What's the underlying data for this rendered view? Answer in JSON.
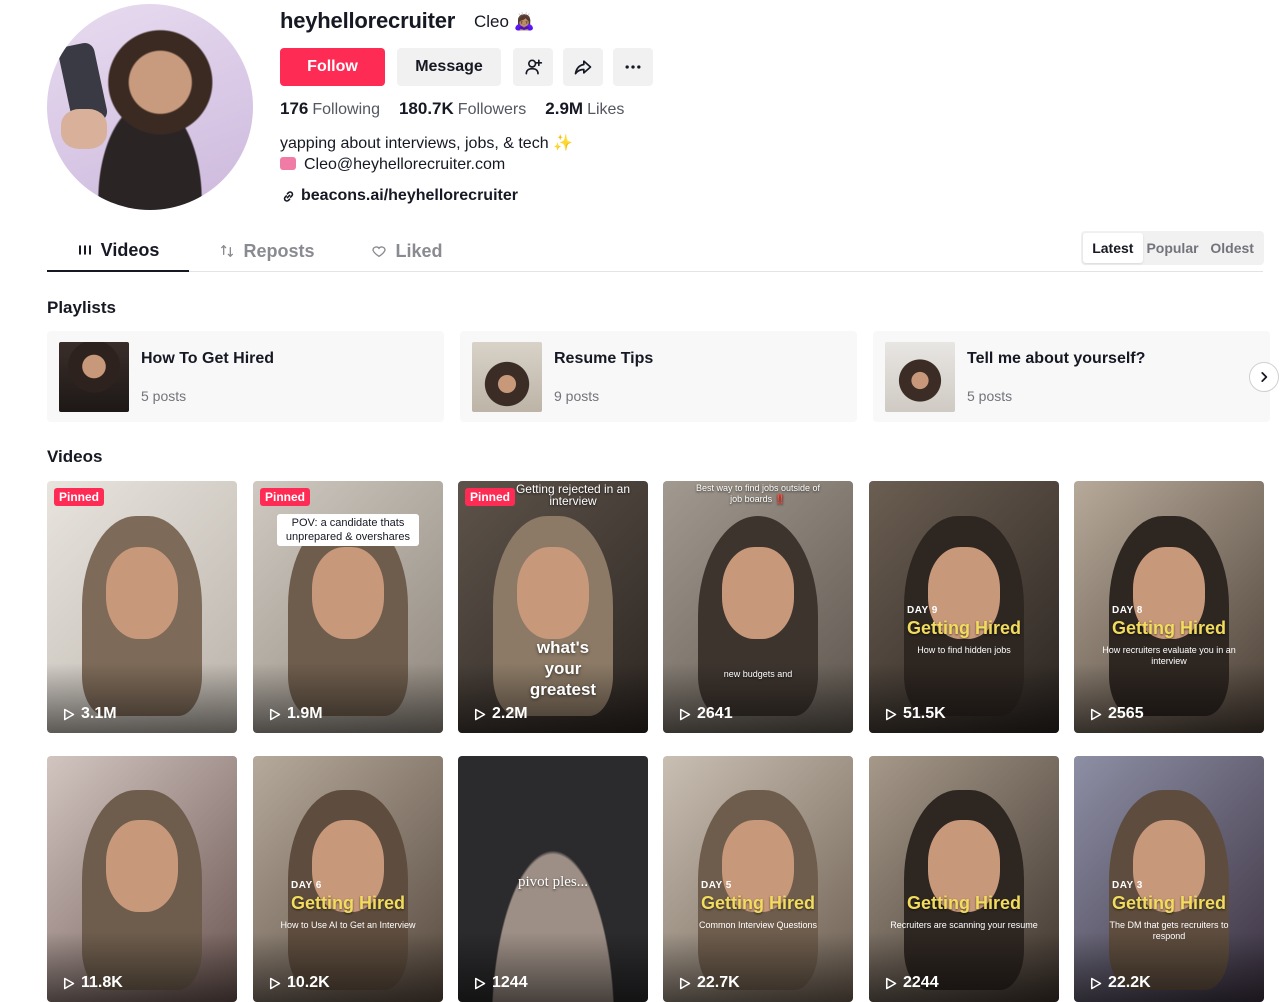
{
  "profile": {
    "username": "heyhellorecruiter",
    "nickname": "Cleo 🙇🏽‍♀️",
    "follow_label": "Follow",
    "message_label": "Message",
    "stats": {
      "following_count": "176",
      "following_label": "Following",
      "followers_count": "180.7K",
      "followers_label": "Followers",
      "likes_count": "2.9M",
      "likes_label": "Likes"
    },
    "bio_line1": "yapping about interviews, jobs, & tech ✨",
    "bio_line2": "Cleo@heyhellorecruiter.com",
    "link": "beacons.ai/heyhellorecruiter"
  },
  "tabs": {
    "videos": "Videos",
    "reposts": "Reposts",
    "liked": "Liked"
  },
  "sort": {
    "latest": "Latest",
    "popular": "Popular",
    "oldest": "Oldest",
    "selected": "Latest"
  },
  "playlists_title": "Playlists",
  "playlists": [
    {
      "name": "How To Get Hired",
      "count": "5 posts"
    },
    {
      "name": "Resume Tips",
      "count": "9 posts"
    },
    {
      "name": "Tell me about yourself?",
      "count": "5 posts"
    }
  ],
  "videos_title": "Videos",
  "pinned_label": "Pinned",
  "videos": [
    {
      "views": "3.1M",
      "pinned": true
    },
    {
      "views": "1.9M",
      "pinned": true,
      "caption": "POV: a candidate thats unprepared & overshares"
    },
    {
      "views": "2.2M",
      "pinned": true,
      "caption": "Getting rejected in an interview",
      "overlay": "what's your greatest"
    },
    {
      "views": "2641",
      "caption": "Best way to find jobs outside of job boards ‼️",
      "overlay": "new budgets and"
    },
    {
      "views": "51.5K",
      "day": "DAY 9",
      "title": "Getting Hired",
      "sub": "How to find hidden jobs"
    },
    {
      "views": "2565",
      "day": "DAY 8",
      "title": "Getting Hired",
      "sub": "How recruiters evaluate you in an interview"
    },
    {
      "views": "11.8K"
    },
    {
      "views": "10.2K",
      "day": "DAY 6",
      "title": "Getting Hired",
      "sub": "How to Use AI to Get an Interview"
    },
    {
      "views": "1244",
      "overlay": "pivot ples..."
    },
    {
      "views": "22.7K",
      "day": "DAY 5",
      "title": "Getting Hired",
      "sub": "Common Interview Questions"
    },
    {
      "views": "2244",
      "title": "Getting Hired",
      "sub": "Recruiters are scanning your resume"
    },
    {
      "views": "22.2K",
      "day": "DAY 3",
      "title": "Getting Hired",
      "sub": "The DM that gets recruiters to respond"
    }
  ]
}
